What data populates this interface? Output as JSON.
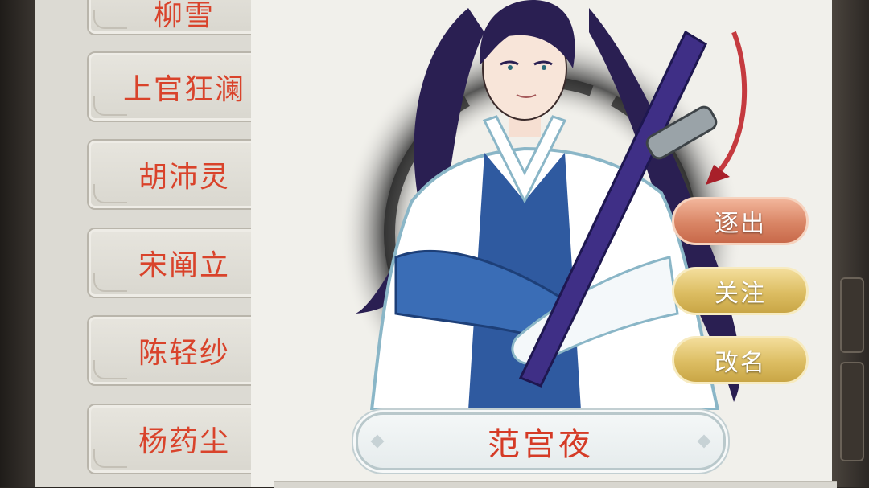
{
  "roster": {
    "items": [
      {
        "label": "柳雪"
      },
      {
        "label": "上官狂澜"
      },
      {
        "label": "胡沛灵"
      },
      {
        "label": "宋阐立"
      },
      {
        "label": "陈轻纱"
      },
      {
        "label": "杨药尘"
      }
    ]
  },
  "character": {
    "name": "范宫夜",
    "portrait_icon": "swordsman-portrait"
  },
  "actions": {
    "expel_label": "逐出",
    "follow_label": "关注",
    "rename_label": "改名"
  },
  "colors": {
    "name_text": "#d9432b",
    "expel_button": "#d98565",
    "gold_button": "#dcbd62"
  }
}
